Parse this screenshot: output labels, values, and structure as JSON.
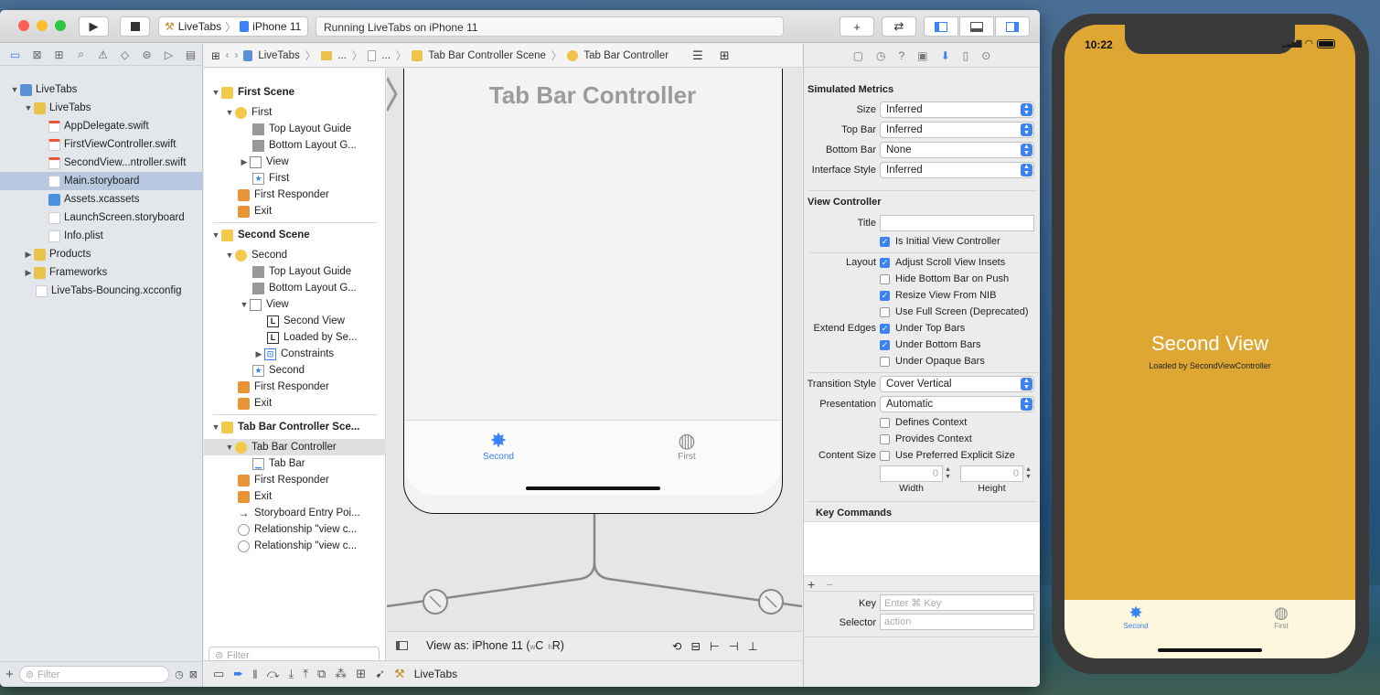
{
  "window": {
    "scheme_app": "LiveTabs",
    "scheme_device": "iPhone 11",
    "activity": "Running LiveTabs on iPhone 11"
  },
  "navigator": {
    "items": [
      {
        "label": "LiveTabs"
      },
      {
        "label": "LiveTabs"
      },
      {
        "label": "AppDelegate.swift"
      },
      {
        "label": "FirstViewController.swift"
      },
      {
        "label": "SecondView...ntroller.swift"
      },
      {
        "label": "Main.storyboard"
      },
      {
        "label": "Assets.xcassets"
      },
      {
        "label": "LaunchScreen.storyboard"
      },
      {
        "label": "Info.plist"
      },
      {
        "label": "Products"
      },
      {
        "label": "Frameworks"
      },
      {
        "label": "LiveTabs-Bouncing.xcconfig"
      }
    ],
    "filter_placeholder": "Filter"
  },
  "jumpbar": {
    "items": [
      "LiveTabs",
      "...",
      "...",
      "Tab Bar Controller Scene",
      "Tab Bar Controller"
    ]
  },
  "outline": {
    "rows": [
      "First Scene",
      "First",
      "Top Layout Guide",
      "Bottom Layout G...",
      "View",
      "First",
      "First Responder",
      "Exit",
      "Second Scene",
      "Second",
      "Top Layout Guide",
      "Bottom Layout G...",
      "View",
      "Second View",
      "Loaded by Se...",
      "Constraints",
      "Second",
      "First Responder",
      "Exit",
      "Tab Bar Controller Sce...",
      "Tab Bar Controller",
      "Tab Bar",
      "First Responder",
      "Exit",
      "Storyboard Entry Poi...",
      "Relationship \"view c...",
      "Relationship \"view c..."
    ],
    "filter_placeholder": "Filter"
  },
  "canvas": {
    "title": "Tab Bar Controller",
    "tab_second": "Second",
    "tab_first": "First",
    "view_as": "View as: iPhone 11 (",
    "view_as_w": "w",
    "view_as_c": "C",
    "view_as_h": "h",
    "view_as_r": "R)"
  },
  "bottombar": {
    "label": "LiveTabs"
  },
  "inspector": {
    "simulated_metrics": "Simulated Metrics",
    "size_label": "Size",
    "size_value": "Inferred",
    "topbar_label": "Top Bar",
    "topbar_value": "Inferred",
    "bottombar_label": "Bottom Bar",
    "bottombar_value": "None",
    "interface_label": "Interface Style",
    "interface_value": "Inferred",
    "view_controller": "View Controller",
    "title_label": "Title",
    "is_initial": "Is Initial View Controller",
    "layout_label": "Layout",
    "adjust_scroll": "Adjust Scroll View Insets",
    "hide_bottom": "Hide Bottom Bar on Push",
    "resize_nib": "Resize View From NIB",
    "full_screen": "Use Full Screen (Deprecated)",
    "extend_label": "Extend Edges",
    "under_top": "Under Top Bars",
    "under_bottom": "Under Bottom Bars",
    "under_opaque": "Under Opaque Bars",
    "transition_label": "Transition Style",
    "transition_value": "Cover Vertical",
    "presentation_label": "Presentation",
    "presentation_value": "Automatic",
    "defines_context": "Defines Context",
    "provides_context": "Provides Context",
    "content_size_label": "Content Size",
    "preferred_size": "Use Preferred Explicit Size",
    "width_value": "0",
    "height_value": "0",
    "width_label": "Width",
    "height_label": "Height",
    "key_commands": "Key Commands",
    "key_label": "Key",
    "key_placeholder": "Enter ⌘ Key",
    "selector_label": "Selector",
    "selector_placeholder": "action"
  },
  "simulator": {
    "time": "10:22",
    "title": "Second View",
    "subtitle": "Loaded by SecondViewController",
    "tab_second": "Second",
    "tab_first": "First"
  },
  "colors": {
    "accent": "#3b82f6",
    "sim_background": "#dea734",
    "sim_tabbar": "#fdf7de"
  }
}
